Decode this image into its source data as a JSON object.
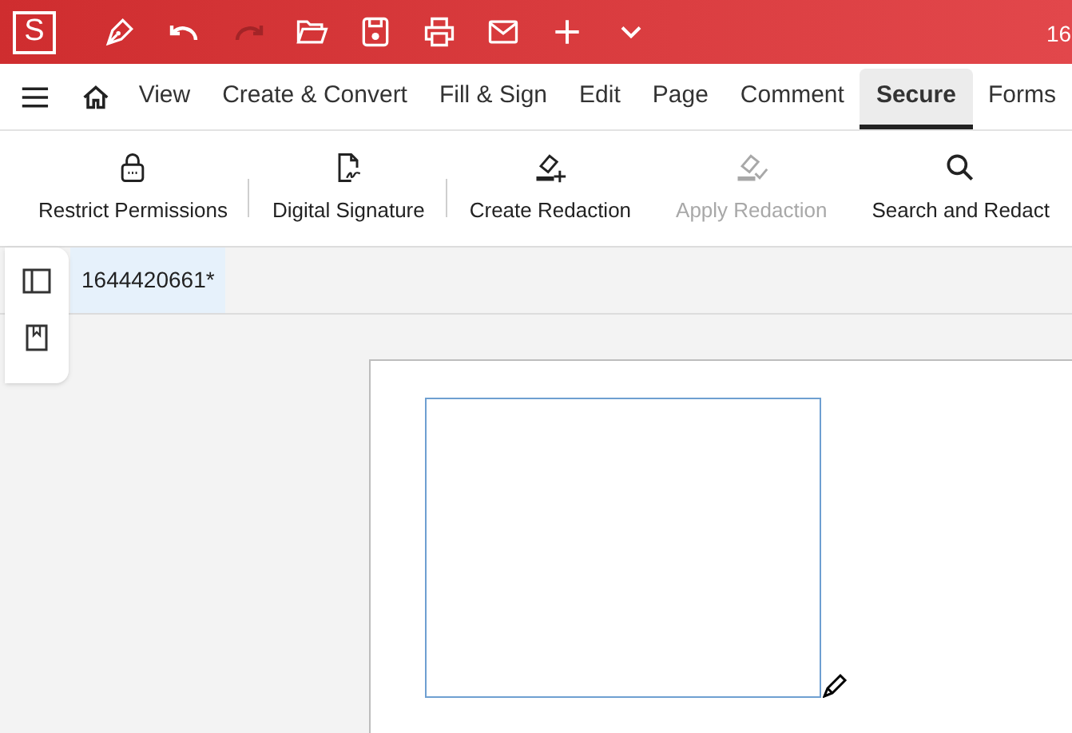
{
  "title_bar": {
    "logo": "S",
    "title": "16"
  },
  "quick_access": [
    {
      "kind": "pen",
      "disabled": false
    },
    {
      "kind": "undo",
      "disabled": false
    },
    {
      "kind": "redo",
      "disabled": true
    },
    {
      "kind": "open",
      "disabled": false
    },
    {
      "kind": "save",
      "disabled": false
    },
    {
      "kind": "print",
      "disabled": false
    },
    {
      "kind": "mail",
      "disabled": false
    },
    {
      "kind": "plus",
      "disabled": false
    },
    {
      "kind": "more",
      "disabled": false
    }
  ],
  "tabs": [
    {
      "label": "View",
      "selected": false
    },
    {
      "label": "Create & Convert",
      "selected": false
    },
    {
      "label": "Fill & Sign",
      "selected": false
    },
    {
      "label": "Edit",
      "selected": false
    },
    {
      "label": "Page",
      "selected": false
    },
    {
      "label": "Comment",
      "selected": false
    },
    {
      "label": "Secure",
      "selected": true
    },
    {
      "label": "Forms",
      "selected": false
    }
  ],
  "ribbon": [
    {
      "kind": "lock",
      "label": "Restrict Permissions",
      "disabled": false,
      "separator_after": true
    },
    {
      "kind": "signature",
      "label": "Digital Signature",
      "disabled": false,
      "separator_after": true
    },
    {
      "kind": "redact",
      "label": "Create Redaction",
      "disabled": false,
      "separator_after": false
    },
    {
      "kind": "apply",
      "label": "Apply Redaction",
      "disabled": true,
      "separator_after": false
    },
    {
      "kind": "search",
      "label": "Search and Redact",
      "disabled": false,
      "separator_after": false
    }
  ],
  "document_tab": {
    "label": "1644420661*",
    "selected": true
  }
}
